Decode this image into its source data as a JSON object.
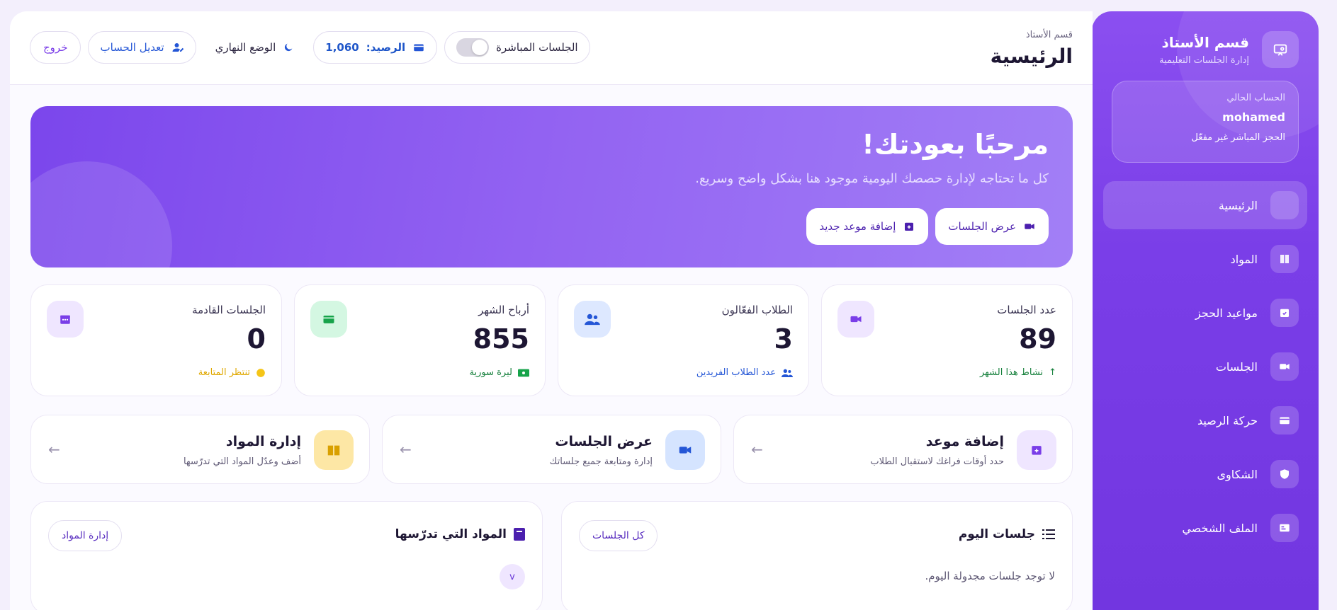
{
  "sidebar": {
    "brand_title": "قسم الأستاذ",
    "brand_subtitle": "إدارة الجلسات التعليمية",
    "account_label": "الحساب الحالي",
    "account_name": "mohamed",
    "account_status": "الحجز المباشر غير مفعّل",
    "items": [
      {
        "label": "الرئيسية",
        "icon": "home-icon",
        "active": true
      },
      {
        "label": "المواد",
        "icon": "book-icon"
      },
      {
        "label": "مواعيد الحجز",
        "icon": "calendar-check-icon"
      },
      {
        "label": "الجلسات",
        "icon": "video-icon"
      },
      {
        "label": "حركة الرصيد",
        "icon": "wallet-icon"
      },
      {
        "label": "الشكاوى",
        "icon": "shield-icon"
      },
      {
        "label": "الملف الشخصي",
        "icon": "id-card-icon"
      }
    ]
  },
  "topbar": {
    "section": "قسم الأستاذ",
    "title": "الرئيسية",
    "live_sessions_label": "الجلسات المباشرة",
    "balance_label": "الرصيد:",
    "balance_value": "1,060",
    "theme_label": "الوضع النهاري",
    "edit_account_label": "تعديل الحساب",
    "logout_label": "خروج"
  },
  "hero": {
    "title": "مرحبًا بعودتك!",
    "subtitle": "كل ما تحتاجه لإدارة حصصك اليومية موجود هنا بشكل واضح وسريع.",
    "btn_sessions": "عرض الجلسات",
    "btn_add": "إضافة موعد جديد"
  },
  "stats": [
    {
      "label": "عدد الجلسات",
      "value": "89",
      "foot": "نشاط هذا الشهر",
      "icon": "video-icon",
      "color": "#7a3ee8",
      "bg": "#efe6ff",
      "foot_color": "#16803c"
    },
    {
      "label": "الطلاب الفعّالون",
      "value": "3",
      "foot": "عدد الطلاب الفريدين",
      "icon": "users-icon",
      "color": "#2456d6",
      "bg": "#dde8ff",
      "foot_color": "#2456d6"
    },
    {
      "label": "أرباح الشهر",
      "value": "855",
      "foot": "ليرة سورية",
      "icon": "wallet-icon",
      "color": "#16a34a",
      "bg": "#d4f7e2",
      "foot_color": "#16803c"
    },
    {
      "label": "الجلسات القادمة",
      "value": "0",
      "foot": "تنتظر المتابعة",
      "icon": "calendar-icon",
      "color": "#7a3ee8",
      "bg": "#efe6ff",
      "foot_color": "#e0a800"
    }
  ],
  "actions": [
    {
      "title": "إضافة موعد",
      "subtitle": "حدد أوقات فراغك لاستقبال الطلاب",
      "icon": "calendar-plus-icon",
      "color": "#7a3ee8",
      "bg": "#efe6ff"
    },
    {
      "title": "عرض الجلسات",
      "subtitle": "إدارة ومتابعة جميع جلساتك",
      "icon": "video-icon",
      "color": "#2456d6",
      "bg": "#d5e4ff"
    },
    {
      "title": "إدارة المواد",
      "subtitle": "أضف وعدّل المواد التي تدرّسها",
      "icon": "book-open-icon",
      "color": "#d9a000",
      "bg": "#fde7a5"
    }
  ],
  "today_panel": {
    "title": "جلسات اليوم",
    "btn": "كل الجلسات",
    "empty": "لا توجد جلسات مجدولة اليوم."
  },
  "subjects_panel": {
    "title": "المواد التي تدرّسها",
    "btn": "إدارة المواد",
    "chevron": "v"
  }
}
